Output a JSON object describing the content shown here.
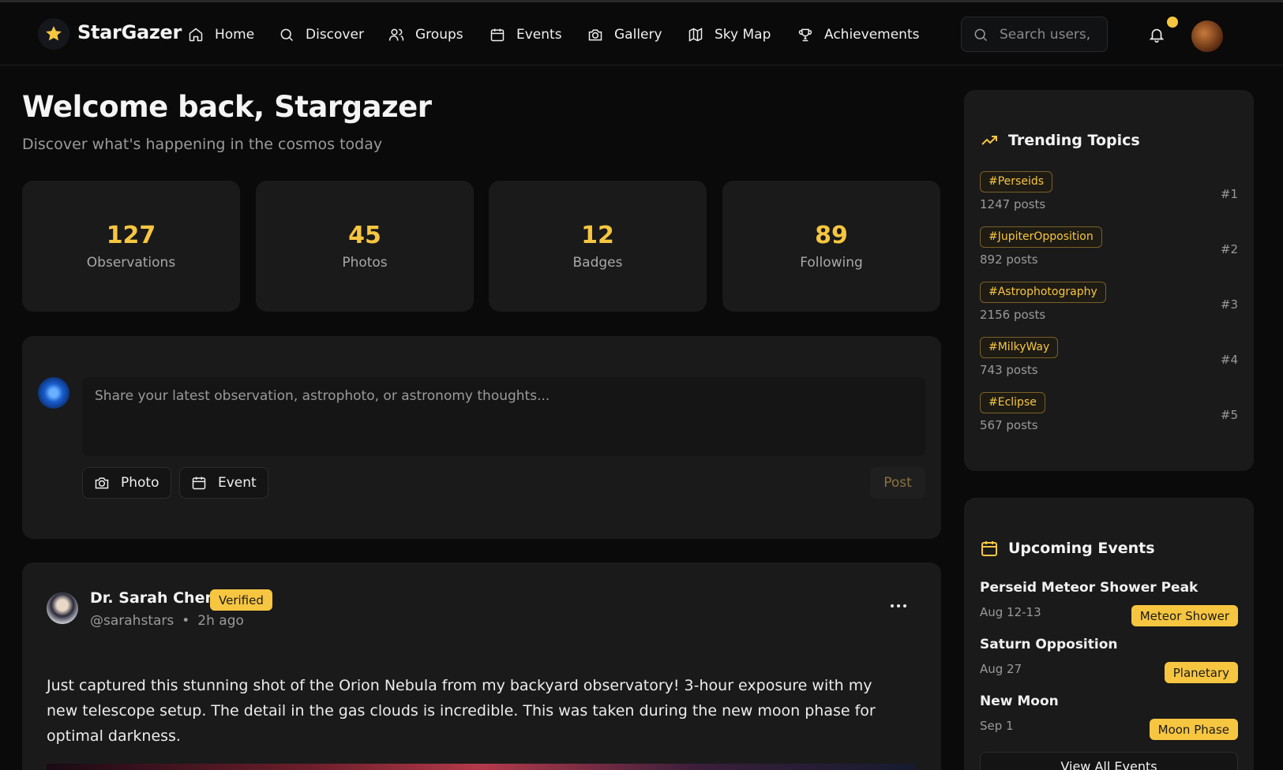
{
  "nav": {
    "brand": "StarGazer",
    "items": [
      {
        "label": "Home",
        "icon": "home-icon"
      },
      {
        "label": "Discover",
        "icon": "search-icon"
      },
      {
        "label": "Groups",
        "icon": "users-icon"
      },
      {
        "label": "Events",
        "icon": "calendar-icon"
      },
      {
        "label": "Gallery",
        "icon": "camera-icon"
      },
      {
        "label": "Sky Map",
        "icon": "map-icon"
      },
      {
        "label": "Achievements",
        "icon": "trophy-icon"
      }
    ],
    "search_placeholder": "Search users, p",
    "accent": "#f7c640"
  },
  "header": {
    "title": "Welcome back, Stargazer",
    "subtitle": "Discover what's happening in the cosmos today"
  },
  "stats": [
    {
      "value": "127",
      "label": "Observations"
    },
    {
      "value": "45",
      "label": "Photos"
    },
    {
      "value": "12",
      "label": "Badges"
    },
    {
      "value": "89",
      "label": "Following"
    }
  ],
  "composer": {
    "placeholder": "Share your latest observation, astrophoto, or astronomy thoughts...",
    "photo_label": "Photo",
    "event_label": "Event",
    "post_label": "Post"
  },
  "post": {
    "author": "Dr. Sarah Chen",
    "badge": "Verified",
    "handle": "@sarahstars",
    "separator": "•",
    "time": "2h ago",
    "body": "Just captured this stunning shot of the Orion Nebula from my backyard observatory! 3-hour exposure with my new telescope setup. The detail in the gas clouds is incredible. This was taken during the new moon phase for optimal darkness."
  },
  "trending": {
    "title": "Trending Topics",
    "topics": [
      {
        "tag": "#Perseids",
        "posts": "1247 posts",
        "rank": "#1"
      },
      {
        "tag": "#JupiterOpposition",
        "posts": "892 posts",
        "rank": "#2"
      },
      {
        "tag": "#Astrophotography",
        "posts": "2156 posts",
        "rank": "#3"
      },
      {
        "tag": "#MilkyWay",
        "posts": "743 posts",
        "rank": "#4"
      },
      {
        "tag": "#Eclipse",
        "posts": "567 posts",
        "rank": "#5"
      }
    ]
  },
  "events": {
    "title": "Upcoming Events",
    "items": [
      {
        "name": "Perseid Meteor Shower Peak",
        "date": "Aug 12-13",
        "type": "Meteor Shower"
      },
      {
        "name": "Saturn Opposition",
        "date": "Aug 27",
        "type": "Planetary"
      },
      {
        "name": "New Moon",
        "date": "Sep 1",
        "type": "Moon Phase"
      }
    ],
    "view_all": "View All Events"
  }
}
